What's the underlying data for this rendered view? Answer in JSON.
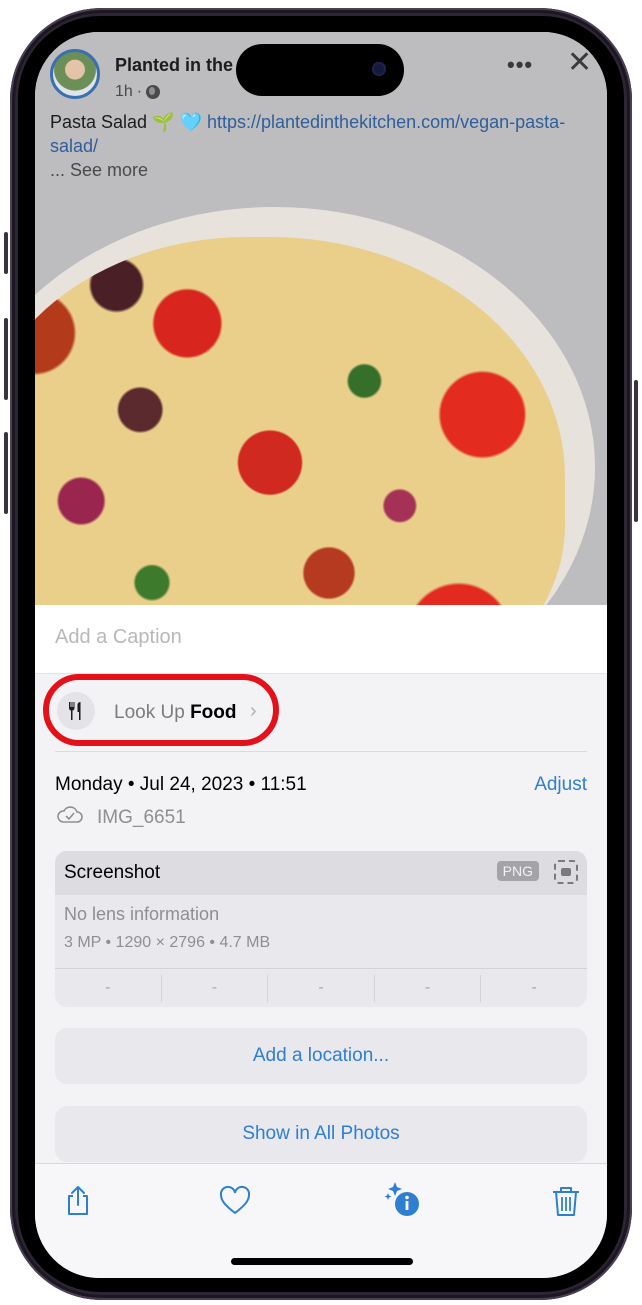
{
  "post": {
    "author": "Planted in the",
    "time": "1h",
    "separator": "·",
    "text": "Pasta Salad",
    "sprout_emoji": "🌱",
    "heart_emoji": "🩵",
    "link": "https://plantedinthekitchen.com/vegan-pasta-salad/",
    "see_more": "... See more",
    "more_icon": "•••",
    "close_icon": "✕"
  },
  "photo": {
    "description": "Pasta salad in a white bowl"
  },
  "info": {
    "caption_placeholder": "Add a Caption",
    "lookup_prefix": "Look Up",
    "lookup_subject": "Food",
    "lookup_chevron": "›",
    "lookup_icon": "🍴",
    "date": "Monday • Jul 24, 2023 • 11:51",
    "adjust_label": "Adjust",
    "filename": "IMG_6651",
    "exif": {
      "title": "Screenshot",
      "format_badge": "PNG",
      "lens": "No lens information",
      "specs": "3 MP • 1290 × 2796 • 4.7 MB",
      "cells": [
        "-",
        "-",
        "-",
        "-",
        "-"
      ]
    },
    "add_location_label": "Add a location...",
    "show_all_label": "Show in All Photos"
  },
  "toolbar": {
    "items": [
      {
        "name": "share"
      },
      {
        "name": "favorite"
      },
      {
        "name": "info"
      },
      {
        "name": "delete"
      }
    ]
  },
  "colors": {
    "accent": "#2f7fd1",
    "highlight": "#e3111a",
    "link": "#2f5e9a"
  }
}
